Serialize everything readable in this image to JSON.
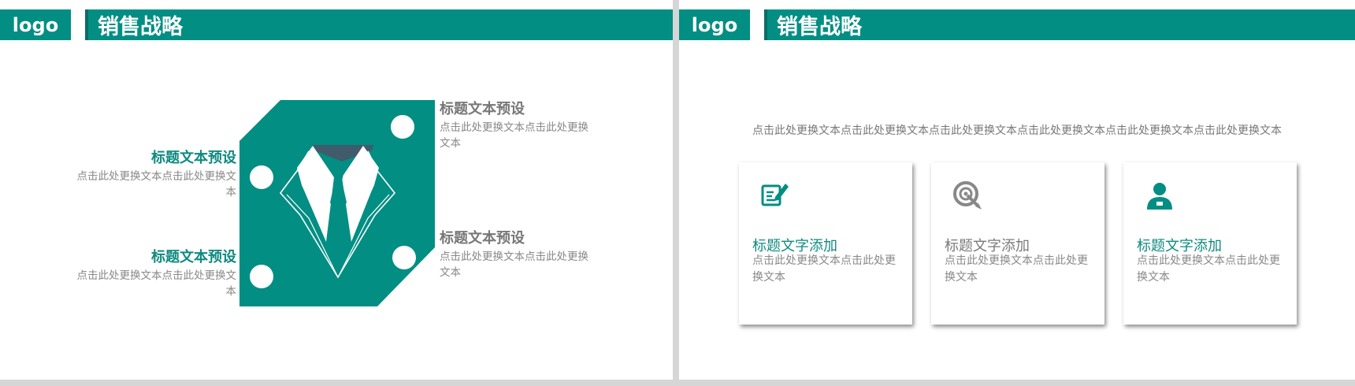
{
  "colors": {
    "accent": "#028e83",
    "navy": "#3f5b6c"
  },
  "left_slide": {
    "logo": "logo",
    "title": "销售战略",
    "blocks": [
      {
        "title": "标题文本预设",
        "desc": "点击此处更换文本点击此处更换文本"
      },
      {
        "title": "标题文本预设",
        "desc": "点击此处更换文本点击此处更换文本"
      },
      {
        "title": "标题文本预设",
        "desc": "点击此处更换文本点击此处更换文本"
      },
      {
        "title": "标题文本预设",
        "desc": "点击此处更换文本点击此处更换文本"
      }
    ]
  },
  "right_slide": {
    "logo": "logo",
    "title": "销售战略",
    "intro": "点击此处更换文本点击此处更换文本点击此处更换文本点击此处更换文本点击此处更换文本点击此处更换文本",
    "cards": [
      {
        "icon": "edit-icon",
        "title": "标题文字添加",
        "desc": "点击此处更换文本点击此处更换文本"
      },
      {
        "icon": "target-icon",
        "title": "标题文字添加",
        "desc": "点击此处更换文本点击此处更换文本"
      },
      {
        "icon": "user-icon",
        "title": "标题文字添加",
        "desc": "点击此处更换文本点击此处更换文本"
      }
    ]
  }
}
